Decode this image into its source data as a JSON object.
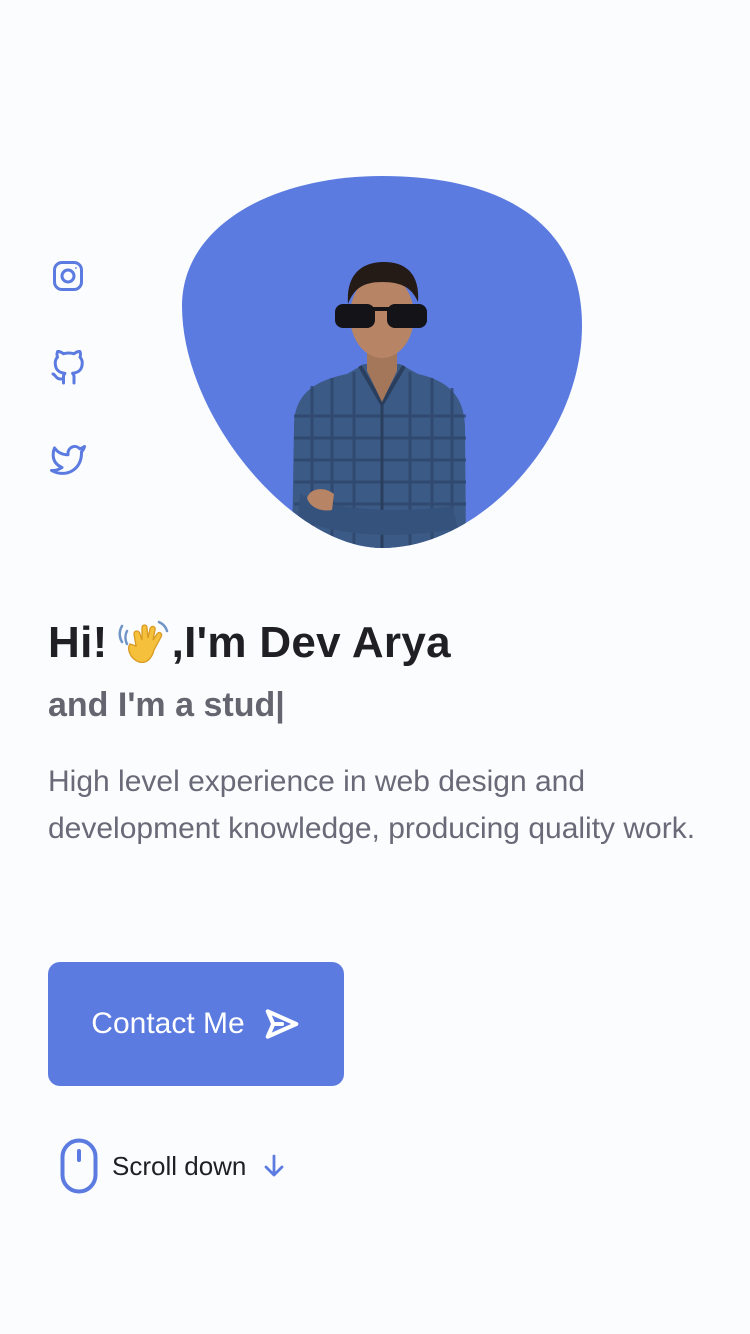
{
  "social": [
    {
      "icon": "instagram-icon"
    },
    {
      "icon": "github-icon"
    },
    {
      "icon": "twitter-icon"
    }
  ],
  "hero": {
    "greeting": "Hi!",
    "greeting_emoji": "waving-hand",
    "name_line": ",I'm Dev Arya",
    "typing_text": "and I'm a stud|",
    "description": "High level experience in web design and development knowledge, producing quality work.",
    "contact_label": "Contact Me",
    "scroll_label": "Scroll down"
  },
  "colors": {
    "accent": "#5b7be0",
    "heading": "#1f1f24",
    "subtitle": "#65656f",
    "body_text": "#696977",
    "background": "#fbfcfe"
  }
}
